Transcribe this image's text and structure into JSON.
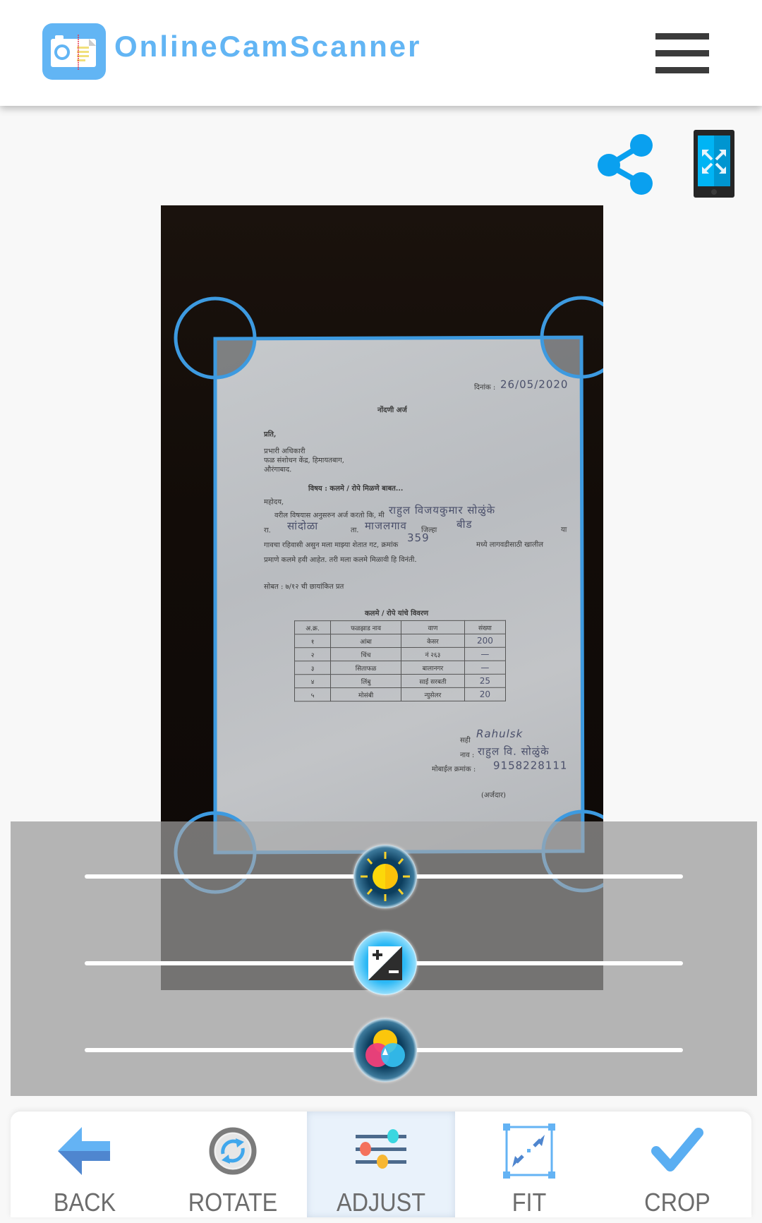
{
  "app": {
    "title": "OnlineCamScanner",
    "menu_icon": "hamburger-menu-icon"
  },
  "actions": {
    "share_icon": "share-icon",
    "fullscreen_icon": "fullscreen-phone-icon"
  },
  "document": {
    "date_label": "दिनांक :",
    "date_value": "26/05/2020",
    "title": "नोंदणी अर्ज",
    "to": "प्रति,",
    "address_lines": [
      "प्रभारी अधिकारी",
      "फळ संशोधन केंद्र, हिमायतबाग,",
      "औरंगाबाद."
    ],
    "subject": "विषय : कलमे / रोपे मिळणे बाबत...",
    "salutation": "महोदय,",
    "body_line1": "वरील विषयास अनुसरुन अर्ज करतो कि, मी",
    "name_hand": "राहुल विजयकुमार सोळुंके",
    "body_line2_prefix": "रा.",
    "village_hand": "सांदोळा",
    "taluka_label": "ता.",
    "taluka_hand": "माजलगाव",
    "district_label": "जिल्हा",
    "district_hand": "बीड",
    "body_line2_suffix": "या",
    "body_line3": "गावचा रहिवासी असुन मला माझ्या शेतात गट, क्रमांक",
    "gat_hand": "359",
    "body_line3_suffix": "मध्ये लागवडीसाठी खालील",
    "body_line4": "प्रमाणे कलमे हवी आहेत. तरी मला कलमे मिळावी हि विनंती.",
    "enclosure": "सोबत : ७/१२ ची छायांकित प्रत",
    "table_title": "कलमे / रोपे यांचे विवरण",
    "table_headers": [
      "अ.क्र.",
      "फळझाड नाव",
      "वाण",
      "संख्या"
    ],
    "table_rows": [
      [
        "१",
        "आंबा",
        "केसर",
        "200"
      ],
      [
        "२",
        "चिंच",
        "नं २६३",
        "—"
      ],
      [
        "३",
        "सिताफळ",
        "बालानगर",
        "—"
      ],
      [
        "४",
        "लिंबु",
        "साई सरबती",
        "25"
      ],
      [
        "५",
        "मोसंबी",
        "न्युसेलर",
        "20"
      ]
    ],
    "sign_label": "सही",
    "sign_hand": "Rahulsk",
    "name_label": "नाव :",
    "short_name_hand": "राहुल वि. सोळुंके",
    "mobile_label": "मोबाईल क्रमांक :",
    "mobile_hand": "9158228111",
    "applicant": "(अर्जदार)"
  },
  "adjust": {
    "sliders": [
      {
        "name": "brightness",
        "icon": "brightness-sun-icon",
        "value_percent": 50
      },
      {
        "name": "contrast",
        "icon": "contrast-icon",
        "value_percent": 50
      },
      {
        "name": "saturation",
        "icon": "color-saturation-icon",
        "value_percent": 50
      }
    ]
  },
  "toolbar": {
    "items": [
      {
        "label": "BACK",
        "icon": "back-arrow-icon",
        "active": false
      },
      {
        "label": "ROTATE",
        "icon": "rotate-icon",
        "active": false
      },
      {
        "label": "ADJUST",
        "icon": "adjust-sliders-icon",
        "active": true
      },
      {
        "label": "FIT",
        "icon": "fit-expand-icon",
        "active": false
      },
      {
        "label": "CROP",
        "icon": "crop-check-icon",
        "active": false
      }
    ]
  },
  "colors": {
    "brand": "#62b5f4",
    "crop_line": "#3d9ae0",
    "menu": "#3b3b3b",
    "toolbar_label": "#6c6c6c",
    "active_tab_bg": "#e9f2fb"
  }
}
